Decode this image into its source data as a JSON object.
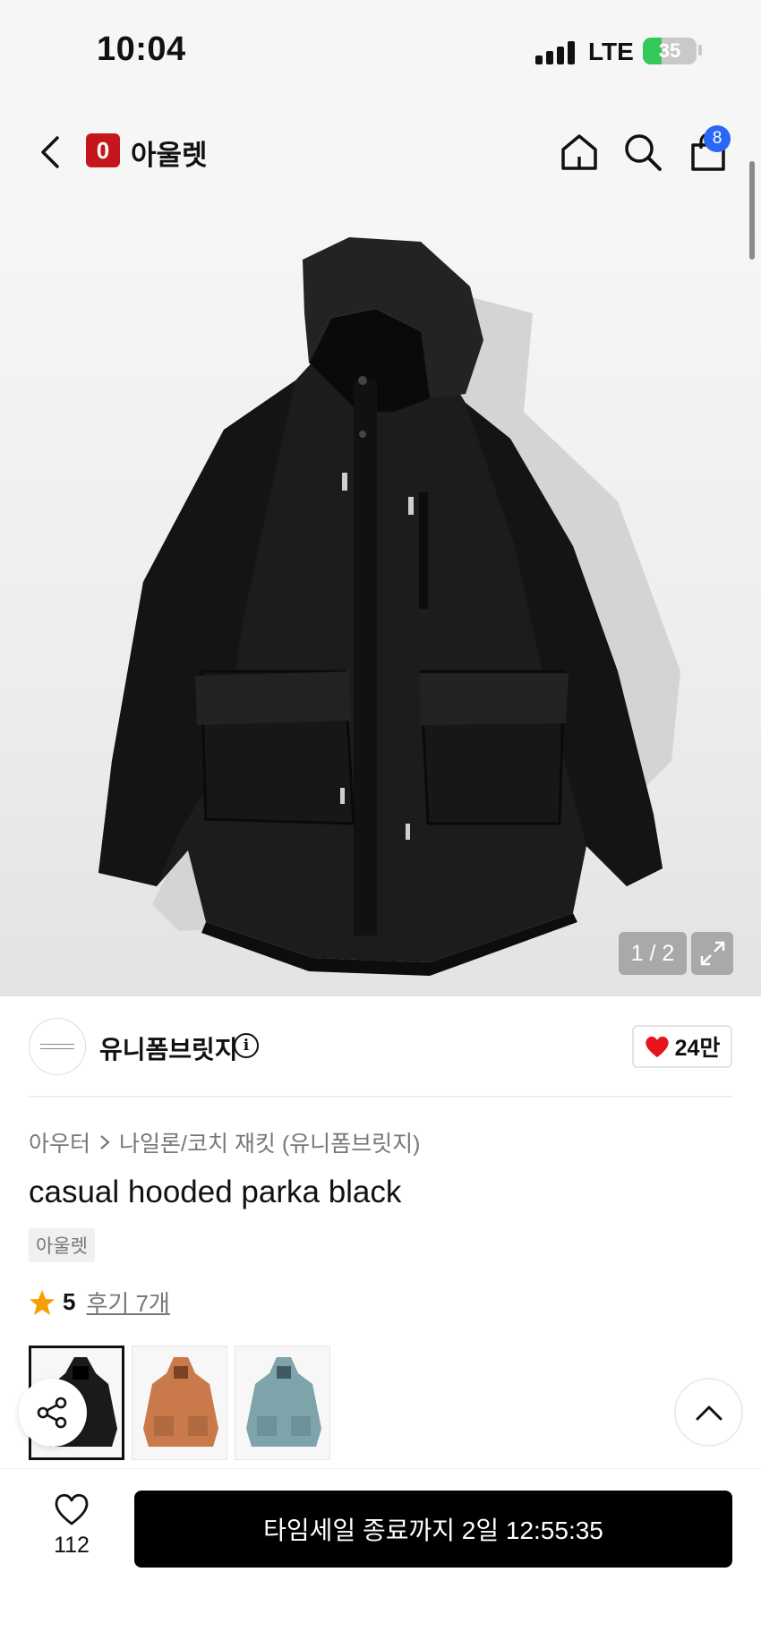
{
  "status_bar": {
    "time": "10:04",
    "network": "LTE",
    "battery": "35"
  },
  "header": {
    "brand_logo_letter": "0",
    "brand_name": "아울렛",
    "cart_count": "8"
  },
  "gallery": {
    "page_indicator": "1 / 2"
  },
  "seller": {
    "name": "유니폼브릿지",
    "like_count": "24만"
  },
  "product": {
    "breadcrumb": [
      "아우터",
      "나일론/코치 재킷 (유니폼브릿지)"
    ],
    "title": "casual hooded parka black",
    "tag": "아울렛",
    "rating": "5",
    "review_link": "후기 7개",
    "color_thumbnails": [
      "black",
      "orange",
      "sky-blue"
    ]
  },
  "bottom_bar": {
    "wish_count": "112",
    "timesale_button": "타임세일 종료까지 2일 12:55:35"
  },
  "colors": {
    "brand_red": "#c4161c",
    "badge_blue": "#2a67f5",
    "heart_red": "#e8141c",
    "star_orange": "#f5a000",
    "thumb_orange": "#c9794a",
    "thumb_blue": "#7ea3ab"
  }
}
